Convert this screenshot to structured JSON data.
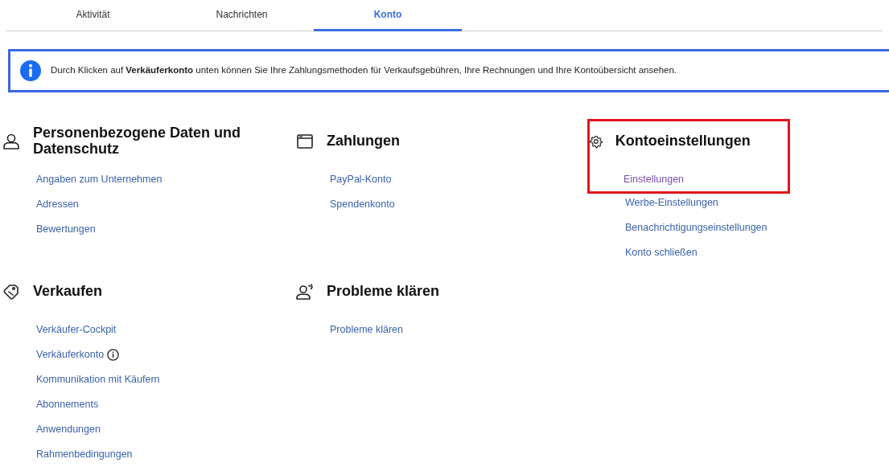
{
  "tabs": [
    {
      "label": "Aktivität",
      "selected": false
    },
    {
      "label": "Nachrichten",
      "selected": false
    },
    {
      "label": "Konto",
      "selected": true
    }
  ],
  "notice": {
    "text": "Durch Klicken auf **Verkäuferkonto** unten können Sie Ihre Zahlungsmethoden für Verkaufsgebühren, Ihre Rechnungen und Ihre Kontoübersicht ansehen."
  },
  "sections": [
    {
      "kind": "person",
      "title": "Personenbezogene Daten und Datenschutz",
      "highlighted": false,
      "links": [
        {
          "label": "Angaben zum Unternehmen",
          "visited": false,
          "info": false
        },
        {
          "label": "Adressen",
          "visited": false,
          "info": false
        },
        {
          "label": "Bewertungen",
          "visited": false,
          "info": false
        }
      ]
    },
    {
      "kind": "payment",
      "title": "Zahlungen",
      "highlighted": false,
      "links": [
        {
          "label": "PayPal-Konto",
          "visited": false,
          "info": false
        },
        {
          "label": "Spendenkonto",
          "visited": false,
          "info": false
        }
      ]
    },
    {
      "kind": "settings",
      "title": "Kontoeinstellungen",
      "highlighted": true,
      "links": [
        {
          "label": "Einstellungen",
          "visited": true,
          "info": false
        },
        {
          "label": "Werbe-Einstellungen",
          "visited": false,
          "info": false
        },
        {
          "label": "Benachrichtigungseinstellungen",
          "visited": false,
          "info": false
        },
        {
          "label": "Konto schließen",
          "visited": false,
          "info": false
        }
      ]
    },
    {
      "kind": "selling",
      "title": "Verkaufen",
      "highlighted": false,
      "links": [
        {
          "label": "Verkäufer-Cockpit",
          "visited": false,
          "info": false
        },
        {
          "label": "Verkäuferkonto",
          "visited": false,
          "info": true
        },
        {
          "label": "Kommunikation mit Käufern",
          "visited": false,
          "info": false
        },
        {
          "label": "Abonnements",
          "visited": false,
          "info": false
        },
        {
          "label": "Anwendungen",
          "visited": false,
          "info": false
        },
        {
          "label": "Rahmenbedingungen",
          "visited": false,
          "info": false
        }
      ]
    },
    {
      "kind": "help",
      "title": "Probleme klären",
      "highlighted": false,
      "links": [
        {
          "label": "Probleme klären",
          "visited": false,
          "info": false
        }
      ]
    }
  ]
}
